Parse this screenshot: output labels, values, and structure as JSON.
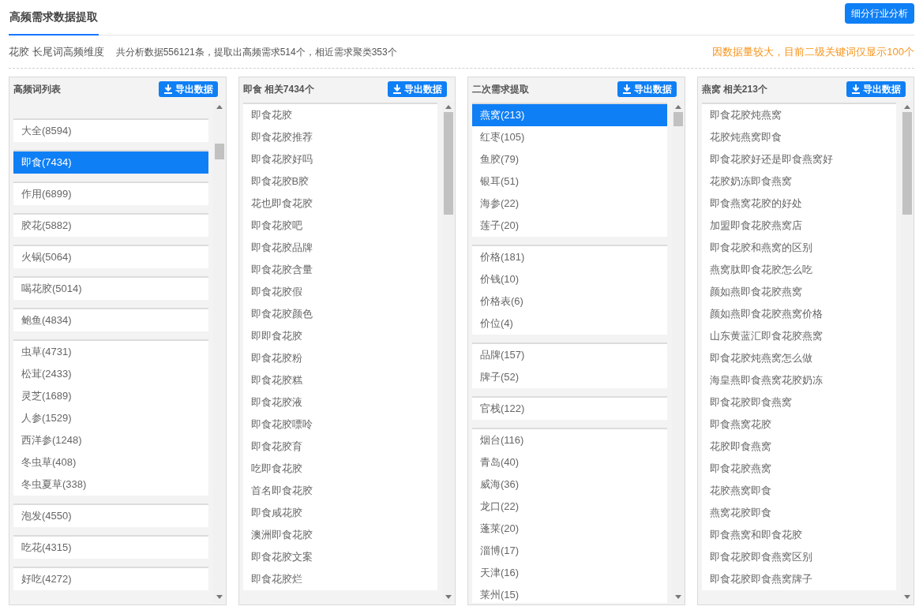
{
  "header": {
    "title": "高频需求数据提取",
    "action_button": "细分行业分析"
  },
  "summary": {
    "keyword": "花胶 长尾词高频维度",
    "stats": "共分析数据556121条，提取出高频需求514个，相近需求聚类353个",
    "notice": "因数据量较大，目前二级关键词仅显示100个"
  },
  "panels": [
    {
      "title": "高频词列表",
      "export_button": "导出数据",
      "groups": [
        {
          "items": [
            {
              "label": "大全(8594)",
              "selected": false
            }
          ]
        },
        {
          "items": [
            {
              "label": "即食(7434)",
              "selected": true
            }
          ]
        },
        {
          "items": [
            {
              "label": "作用(6899)",
              "selected": false
            }
          ]
        },
        {
          "items": [
            {
              "label": "胶花(5882)",
              "selected": false
            }
          ]
        },
        {
          "items": [
            {
              "label": "火锅(5064)",
              "selected": false
            }
          ]
        },
        {
          "items": [
            {
              "label": "喝花胶(5014)",
              "selected": false
            }
          ]
        },
        {
          "items": [
            {
              "label": "鲍鱼(4834)",
              "selected": false
            }
          ]
        },
        {
          "items": [
            {
              "label": "虫草(4731)",
              "selected": false
            },
            {
              "label": "松茸(2433)",
              "selected": false
            },
            {
              "label": "灵芝(1689)",
              "selected": false
            },
            {
              "label": "人参(1529)",
              "selected": false
            },
            {
              "label": "西洋参(1248)",
              "selected": false
            },
            {
              "label": "冬虫草(408)",
              "selected": false
            },
            {
              "label": "冬虫夏草(338)",
              "selected": false
            }
          ]
        },
        {
          "items": [
            {
              "label": "泡发(4550)",
              "selected": false
            }
          ]
        },
        {
          "items": [
            {
              "label": "吃花(4315)",
              "selected": false
            }
          ]
        },
        {
          "items": [
            {
              "label": "好吃(4272)",
              "selected": false
            }
          ]
        }
      ]
    },
    {
      "title": "即食 相关7434个",
      "export_button": "导出数据",
      "groups": [
        {
          "items": [
            {
              "label": "即食花胶",
              "selected": false
            },
            {
              "label": "即食花胶推荐",
              "selected": false
            },
            {
              "label": "即食花胶好吗",
              "selected": false
            },
            {
              "label": "即食花胶B胶",
              "selected": false
            },
            {
              "label": "花也即食花胶",
              "selected": false
            },
            {
              "label": "即食花胶吧",
              "selected": false
            },
            {
              "label": "即食花胶品牌",
              "selected": false
            },
            {
              "label": "即食花胶含量",
              "selected": false
            },
            {
              "label": "即食花胶假",
              "selected": false
            },
            {
              "label": "即食花胶颜色",
              "selected": false
            },
            {
              "label": "即即食花胶",
              "selected": false
            },
            {
              "label": "即食花胶粉",
              "selected": false
            },
            {
              "label": "即食花胶糕",
              "selected": false
            },
            {
              "label": "即食花胶液",
              "selected": false
            },
            {
              "label": "即食花胶嘌呤",
              "selected": false
            },
            {
              "label": "即食花胶育",
              "selected": false
            },
            {
              "label": "吃即食花胶",
              "selected": false
            },
            {
              "label": "首名即食花胶",
              "selected": false
            },
            {
              "label": "即食咸花胶",
              "selected": false
            },
            {
              "label": "澳洲即食花胶",
              "selected": false
            },
            {
              "label": "即食花胶文案",
              "selected": false
            },
            {
              "label": "即食花胶烂",
              "selected": false
            }
          ]
        }
      ]
    },
    {
      "title": "二次需求提取",
      "export_button": "导出数据",
      "groups": [
        {
          "items": [
            {
              "label": "燕窝(213)",
              "selected": true
            },
            {
              "label": "红枣(105)",
              "selected": false
            },
            {
              "label": "鱼胶(79)",
              "selected": false
            },
            {
              "label": "银耳(51)",
              "selected": false
            },
            {
              "label": "海参(22)",
              "selected": false
            },
            {
              "label": "莲子(20)",
              "selected": false
            }
          ]
        },
        {
          "items": [
            {
              "label": "价格(181)",
              "selected": false
            },
            {
              "label": "价钱(10)",
              "selected": false
            },
            {
              "label": "价格表(6)",
              "selected": false
            },
            {
              "label": "价位(4)",
              "selected": false
            }
          ]
        },
        {
          "items": [
            {
              "label": "品牌(157)",
              "selected": false
            },
            {
              "label": "牌子(52)",
              "selected": false
            }
          ]
        },
        {
          "items": [
            {
              "label": "官栈(122)",
              "selected": false
            }
          ]
        },
        {
          "items": [
            {
              "label": "烟台(116)",
              "selected": false
            },
            {
              "label": "青岛(40)",
              "selected": false
            },
            {
              "label": "威海(36)",
              "selected": false
            },
            {
              "label": "龙口(22)",
              "selected": false
            },
            {
              "label": "蓬莱(20)",
              "selected": false
            },
            {
              "label": "淄博(17)",
              "selected": false
            },
            {
              "label": "天津(16)",
              "selected": false
            },
            {
              "label": "莱州(15)",
              "selected": false
            }
          ]
        }
      ]
    },
    {
      "title": "燕窝 相关213个",
      "export_button": "导出数据",
      "groups": [
        {
          "items": [
            {
              "label": "即食花胶炖燕窝",
              "selected": false
            },
            {
              "label": "花胶炖燕窝即食",
              "selected": false
            },
            {
              "label": "即食花胶好还是即食燕窝好",
              "selected": false
            },
            {
              "label": "花胶奶冻即食燕窝",
              "selected": false
            },
            {
              "label": "即食燕窝花胶的好处",
              "selected": false
            },
            {
              "label": "加盟即食花胶燕窝店",
              "selected": false
            },
            {
              "label": "即食花胶和燕窝的区别",
              "selected": false
            },
            {
              "label": "燕窝肽即食花胶怎么吃",
              "selected": false
            },
            {
              "label": "颜如燕即食花胶燕窝",
              "selected": false
            },
            {
              "label": "颜如燕即食花胶燕窝价格",
              "selected": false
            },
            {
              "label": "山东黄蓝汇即食花胶燕窝",
              "selected": false
            },
            {
              "label": "即食花胶炖燕窝怎么做",
              "selected": false
            },
            {
              "label": "海皇燕即食燕窝花胶奶冻",
              "selected": false
            },
            {
              "label": "即食花胶即食燕窝",
              "selected": false
            },
            {
              "label": "即食燕窝花胶",
              "selected": false
            },
            {
              "label": "花胶即食燕窝",
              "selected": false
            },
            {
              "label": "即食花胶燕窝",
              "selected": false
            },
            {
              "label": "花胶燕窝即食",
              "selected": false
            },
            {
              "label": "燕窝花胶即食",
              "selected": false
            },
            {
              "label": "即食燕窝和即食花胶",
              "selected": false
            },
            {
              "label": "即食花胶即食燕窝区别",
              "selected": false
            },
            {
              "label": "即食花胶即食燕窝牌子",
              "selected": false
            }
          ]
        }
      ]
    }
  ]
}
